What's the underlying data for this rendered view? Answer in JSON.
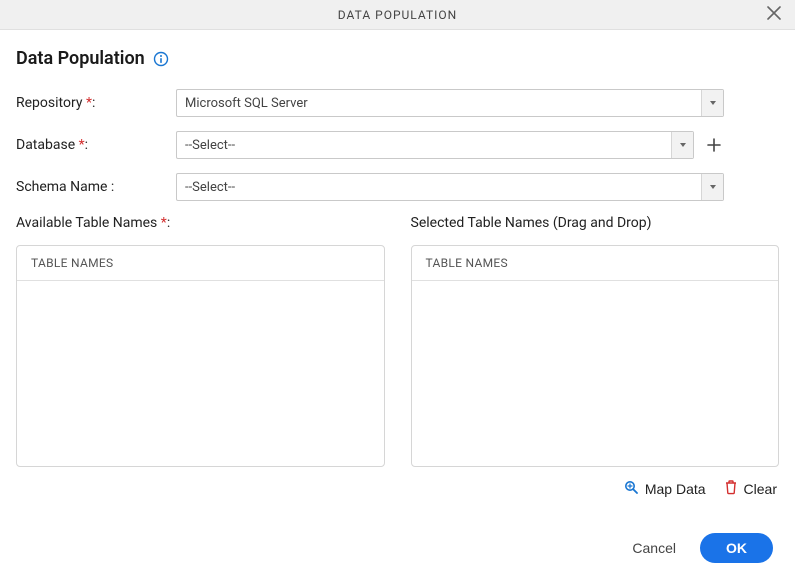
{
  "header": {
    "title": "DATA POPULATION"
  },
  "page": {
    "title": "Data Population"
  },
  "form": {
    "repository": {
      "label": "Repository",
      "value": "Microsoft SQL Server",
      "required_marker": "*",
      "colon": ":"
    },
    "database": {
      "label": "Database",
      "value": "--Select--",
      "required_marker": "*",
      "colon": ":"
    },
    "schema": {
      "label": "Schema Name :",
      "value": "--Select--"
    }
  },
  "tables": {
    "available": {
      "label": "Available Table Names",
      "required_marker": "*",
      "colon": ":",
      "header": "TABLE NAMES"
    },
    "selected": {
      "label": "Selected Table Names (Drag and Drop)",
      "header": "TABLE NAMES"
    }
  },
  "actions": {
    "map_data": "Map Data",
    "clear": "Clear"
  },
  "footer": {
    "cancel": "Cancel",
    "ok": "OK"
  }
}
